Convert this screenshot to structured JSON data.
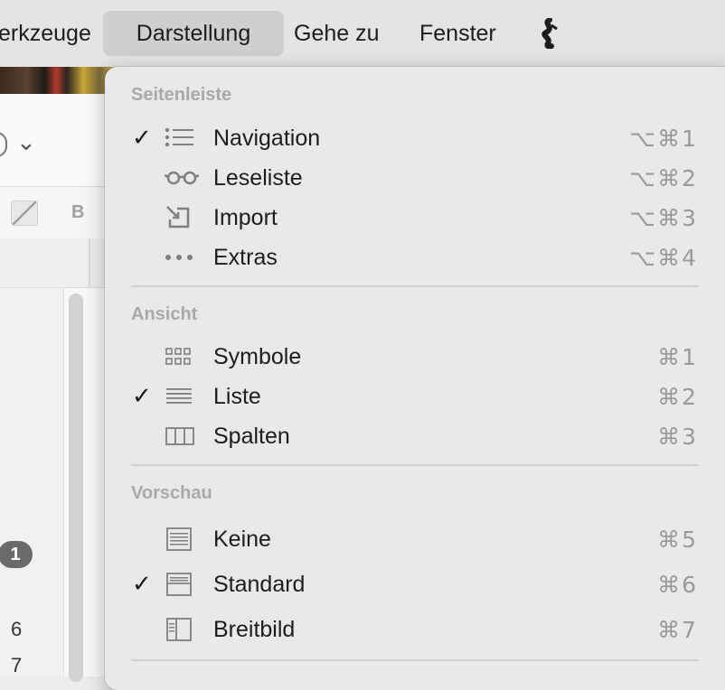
{
  "menubar": {
    "items": [
      "erkzeuge",
      "Darstellung",
      "Gehe zu",
      "Fenster"
    ],
    "active": "Darstellung",
    "extra_icon": "script-icon"
  },
  "background": {
    "chevron": "⌄",
    "format_bold": "B",
    "badge_count": "1",
    "row_numbers": [
      "6",
      "7"
    ]
  },
  "menu": {
    "sections": [
      {
        "title": "Seitenleiste",
        "items": [
          {
            "label": "Navigation",
            "shortcut": "⌥⌘1",
            "checked": true,
            "icon": "list-bullets-icon"
          },
          {
            "label": "Leseliste",
            "shortcut": "⌥⌘2",
            "checked": false,
            "icon": "glasses-icon"
          },
          {
            "label": "Import",
            "shortcut": "⌥⌘3",
            "checked": false,
            "icon": "import-icon"
          },
          {
            "label": "Extras",
            "shortcut": "⌥⌘4",
            "checked": false,
            "icon": "ellipsis-icon"
          }
        ]
      },
      {
        "title": "Ansicht",
        "items": [
          {
            "label": "Symbole",
            "shortcut": "⌘1",
            "checked": false,
            "icon": "grid-icon"
          },
          {
            "label": "Liste",
            "shortcut": "⌘2",
            "checked": true,
            "icon": "list-lines-icon"
          },
          {
            "label": "Spalten",
            "shortcut": "⌘3",
            "checked": false,
            "icon": "columns-icon"
          }
        ]
      },
      {
        "title": "Vorschau",
        "items": [
          {
            "label": "Keine",
            "shortcut": "⌘5",
            "checked": false,
            "icon": "preview-none-icon"
          },
          {
            "label": "Standard",
            "shortcut": "⌘6",
            "checked": true,
            "icon": "preview-standard-icon"
          },
          {
            "label": "Breitbild",
            "shortcut": "⌘7",
            "checked": false,
            "icon": "preview-widescreen-icon"
          }
        ]
      }
    ],
    "check_mark": "✓"
  }
}
